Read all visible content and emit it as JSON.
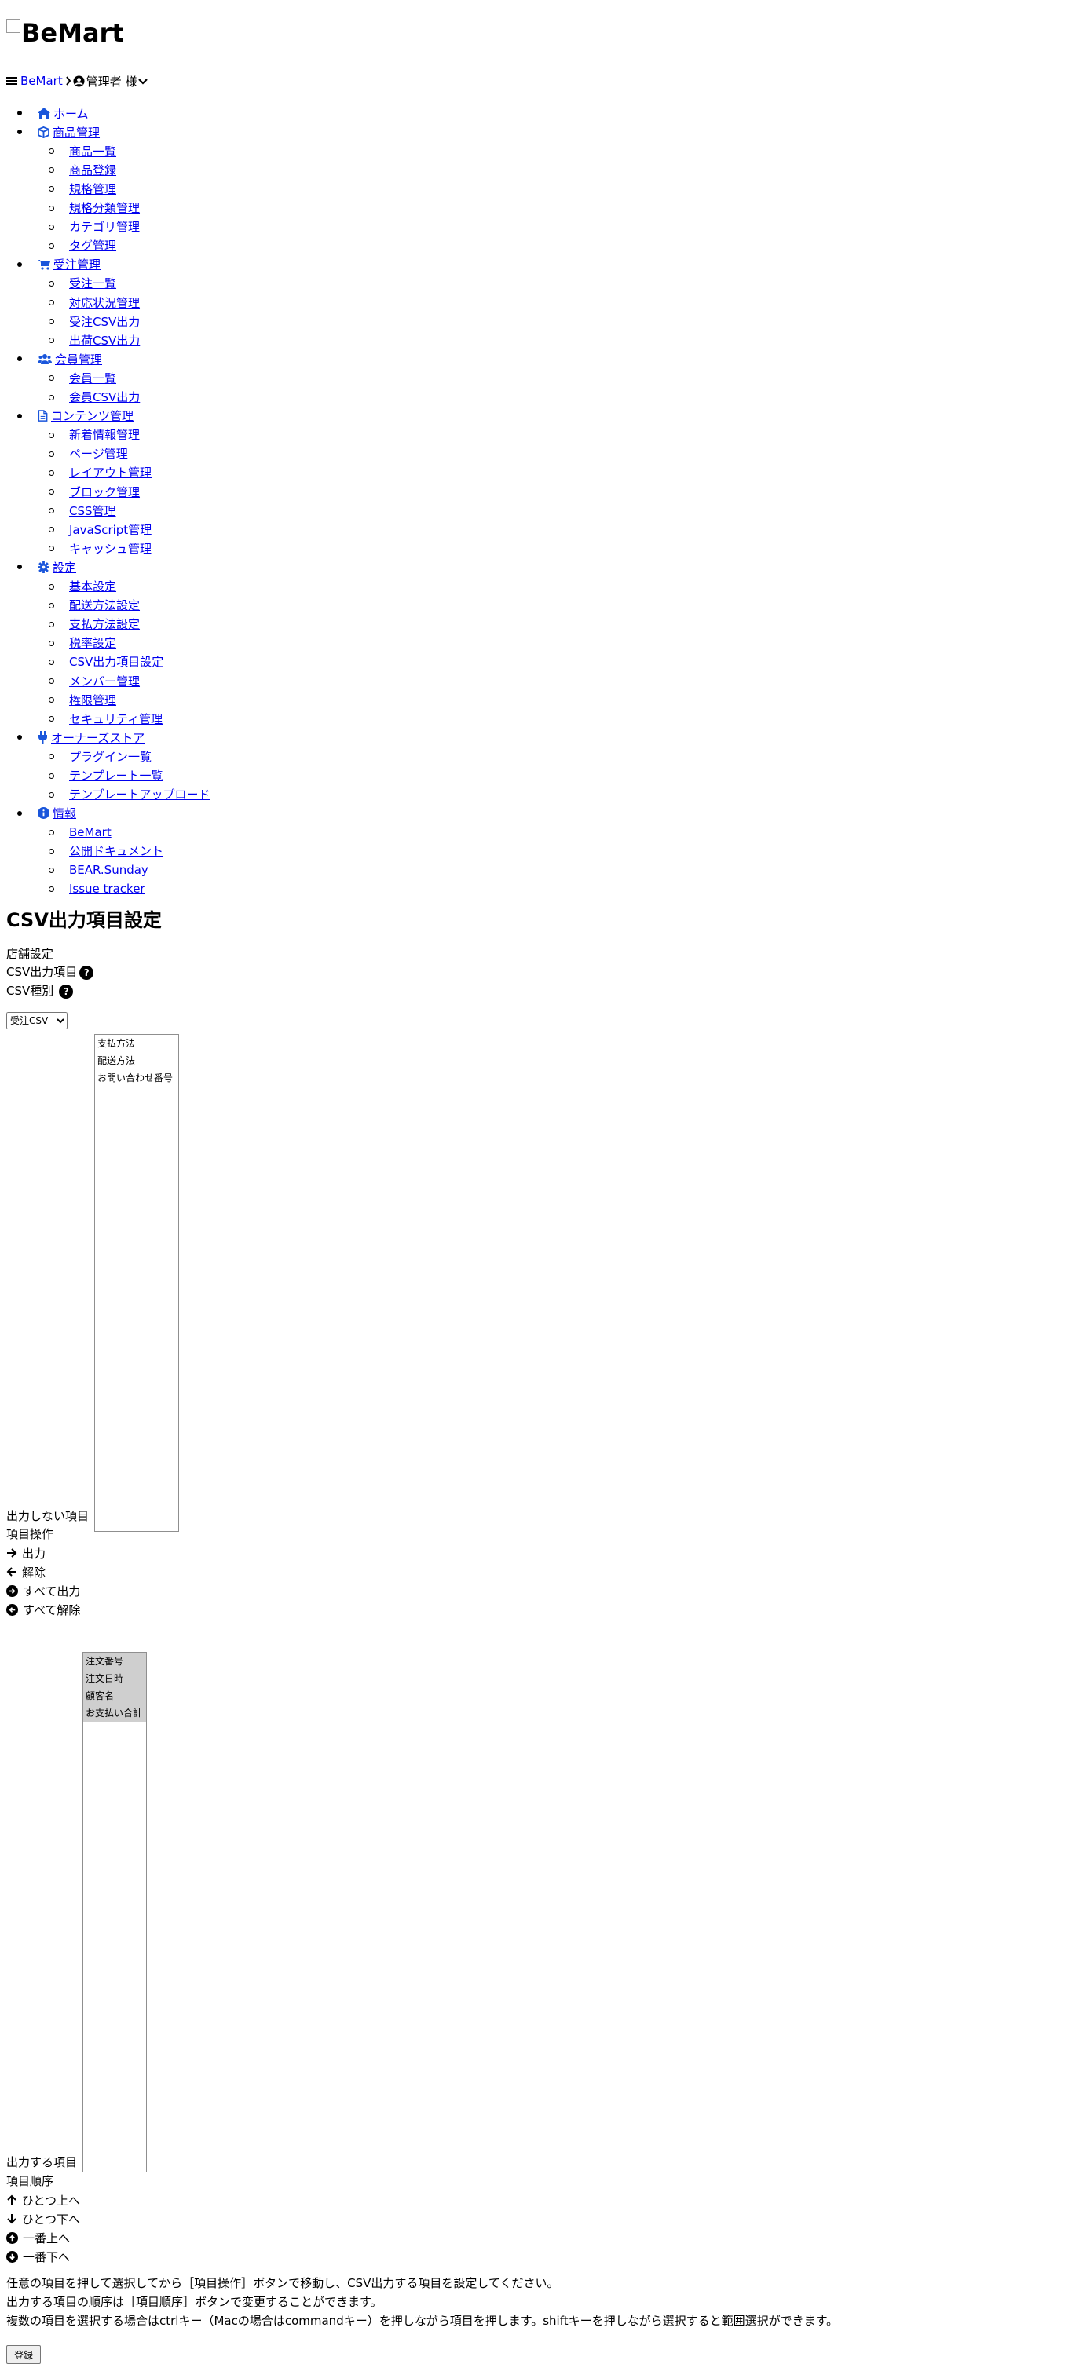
{
  "logo": {
    "alt": "BeMart"
  },
  "header": {
    "brand": "BeMart",
    "user": "管理者 様"
  },
  "nav": [
    {
      "label": "ホーム",
      "icon": "home-icon",
      "children": []
    },
    {
      "label": "商品管理",
      "icon": "box-icon",
      "children": [
        "商品一覧",
        "商品登録",
        "規格管理",
        "規格分類管理",
        "カテゴリ管理",
        "タグ管理"
      ]
    },
    {
      "label": "受注管理",
      "icon": "cart-icon",
      "children": [
        "受注一覧",
        "対応状況管理",
        "受注CSV出力",
        "出荷CSV出力"
      ]
    },
    {
      "label": "会員管理",
      "icon": "users-icon",
      "children": [
        "会員一覧",
        "会員CSV出力"
      ]
    },
    {
      "label": "コンテンツ管理",
      "icon": "file-icon",
      "children": [
        "新着情報管理",
        "ページ管理",
        "レイアウト管理",
        "ブロック管理",
        "CSS管理",
        "JavaScript管理",
        "キャッシュ管理"
      ]
    },
    {
      "label": "設定",
      "icon": "gear-icon",
      "children": [
        "基本設定",
        "配送方法設定",
        "支払方法設定",
        "税率設定",
        "CSV出力項目設定",
        "メンバー管理",
        "権限管理",
        "セキュリティ管理"
      ]
    },
    {
      "label": "オーナーズストア",
      "icon": "plug-icon",
      "children": [
        "プラグイン一覧",
        "テンプレート一覧",
        "テンプレートアップロード"
      ]
    },
    {
      "label": "情報",
      "icon": "info-icon",
      "children": [
        "BeMart",
        "公開ドキュメント",
        "BEAR.Sunday",
        "Issue tracker"
      ]
    }
  ],
  "page": {
    "title": "CSV出力項目設定",
    "section": "店舗設定",
    "csv_items_label": "CSV出力項目",
    "csv_type_label": "CSV種別",
    "csv_type_value": "受注CSV",
    "help_glyph": "?",
    "excluded_label": "出力しない項目",
    "excluded_items": [
      "支払方法",
      "配送方法",
      "お問い合わせ番号"
    ],
    "operations_label": "項目操作",
    "operations": [
      "出力",
      "解除",
      "すべて出力",
      "すべて解除"
    ],
    "included_label": "出力する項目",
    "included_items": [
      "注文番号",
      "注文日時",
      "顧客名",
      "お支払い合計"
    ],
    "order_label": "項目順序",
    "order_ops": [
      "ひとつ上へ",
      "ひとつ下へ",
      "一番上へ",
      "一番下へ"
    ],
    "notes": [
      "任意の項目を押して選択してから［項目操作］ボタンで移動し、CSV出力する項目を設定してください。",
      "出力する項目の順序は［項目順序］ボタンで変更することができます。",
      "複数の項目を選択する場合はctrlキー（Macの場合はcommandキー）を押しながら項目を押します。shiftキーを押しながら選択すると範囲選択ができます。"
    ],
    "submit": "登録"
  }
}
